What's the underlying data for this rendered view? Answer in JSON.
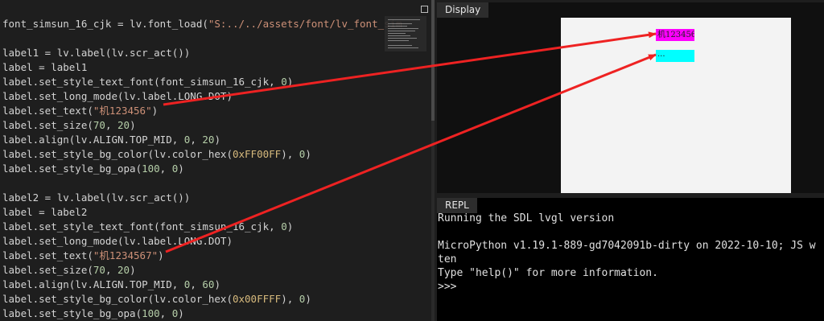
{
  "editor": {
    "lines": [
      [
        {
          "t": "font_simsun_16_cjk = lv.font_load("
        },
        {
          "t": "\"S:../../assets/font/lv_font_sim",
          "c": "str"
        }
      ],
      [
        {
          "t": ""
        }
      ],
      [
        {
          "t": "label1 = lv.label(lv.scr_act())"
        }
      ],
      [
        {
          "t": "label = label1"
        }
      ],
      [
        {
          "t": "label.set_style_text_font(font_simsun_16_cjk, "
        },
        {
          "t": "0",
          "c": "num"
        },
        {
          "t": ")"
        }
      ],
      [
        {
          "t": "label.set_long_mode(lv.label.LONG.DOT)"
        }
      ],
      [
        {
          "t": "label.set_text("
        },
        {
          "t": "\"机123456\"",
          "c": "str"
        },
        {
          "t": ")"
        }
      ],
      [
        {
          "t": "label.set_size("
        },
        {
          "t": "70",
          "c": "num"
        },
        {
          "t": ", "
        },
        {
          "t": "20",
          "c": "num"
        },
        {
          "t": ")"
        }
      ],
      [
        {
          "t": "label.align(lv.ALIGN.TOP_MID, "
        },
        {
          "t": "0",
          "c": "num"
        },
        {
          "t": ", "
        },
        {
          "t": "20",
          "c": "num"
        },
        {
          "t": ")"
        }
      ],
      [
        {
          "t": "label.set_style_bg_color(lv.color_hex("
        },
        {
          "t": "0xFF00FF",
          "c": "hex"
        },
        {
          "t": "), "
        },
        {
          "t": "0",
          "c": "num"
        },
        {
          "t": ")"
        }
      ],
      [
        {
          "t": "label.set_style_bg_opa("
        },
        {
          "t": "100",
          "c": "num"
        },
        {
          "t": ", "
        },
        {
          "t": "0",
          "c": "num"
        },
        {
          "t": ")"
        }
      ],
      [
        {
          "t": ""
        }
      ],
      [
        {
          "t": "label2 = lv.label(lv.scr_act())"
        }
      ],
      [
        {
          "t": "label = label2"
        }
      ],
      [
        {
          "t": "label.set_style_text_font(font_simsun_16_cjk, "
        },
        {
          "t": "0",
          "c": "num"
        },
        {
          "t": ")"
        }
      ],
      [
        {
          "t": "label.set_long_mode(lv.label.LONG.DOT)"
        }
      ],
      [
        {
          "t": "label.set_text("
        },
        {
          "t": "\"机1234567\"",
          "c": "str"
        },
        {
          "t": ")"
        }
      ],
      [
        {
          "t": "label.set_size("
        },
        {
          "t": "70",
          "c": "num"
        },
        {
          "t": ", "
        },
        {
          "t": "20",
          "c": "num"
        },
        {
          "t": ")"
        }
      ],
      [
        {
          "t": "label.align(lv.ALIGN.TOP_MID, "
        },
        {
          "t": "0",
          "c": "num"
        },
        {
          "t": ", "
        },
        {
          "t": "60",
          "c": "num"
        },
        {
          "t": ")"
        }
      ],
      [
        {
          "t": "label.set_style_bg_color(lv.color_hex("
        },
        {
          "t": "0x00FFFF",
          "c": "hex"
        },
        {
          "t": "), "
        },
        {
          "t": "0",
          "c": "num"
        },
        {
          "t": ")"
        }
      ],
      [
        {
          "t": "label.set_style_bg_opa("
        },
        {
          "t": "100",
          "c": "num"
        },
        {
          "t": ", "
        },
        {
          "t": "0",
          "c": "num"
        },
        {
          "t": ")"
        }
      ]
    ]
  },
  "display": {
    "tab_label": "Display",
    "label1_text": "机123456",
    "label2_text": "...",
    "label1_color": "#ff00ff",
    "label2_color": "#00ffff"
  },
  "repl": {
    "tab_label": "REPL",
    "lines": [
      "Running the SDL lvgl version",
      "",
      "MicroPython v1.19.1-889-gd7042091b-dirty on 2022-10-10; JS w",
      "ten",
      "Type \"help()\" for more information.",
      ">>>"
    ]
  },
  "colors": {
    "arrow": "#ee2222",
    "editor_bg": "#1e1e1e",
    "repl_bg": "#000000"
  }
}
